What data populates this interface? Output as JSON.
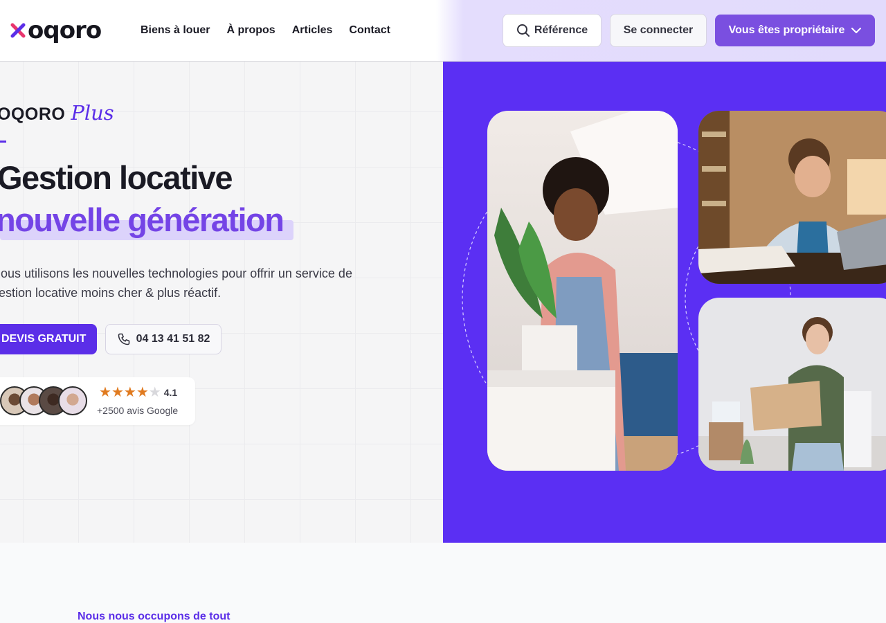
{
  "header": {
    "logo_text": "oqoro",
    "nav": [
      "Biens à louer",
      "À propos",
      "Articles",
      "Contact"
    ],
    "reference_label": "Référence",
    "login_label": "Se connecter",
    "owner_label": "Vous êtes propriétaire"
  },
  "hero": {
    "brand_name": "OQORO",
    "brand_plus": "Plus",
    "title_line1": "Gestion locative",
    "title_line2": "nouvelle génération",
    "lead": "Nous utilisons les nouvelles technologies pour offrir un service de gestion locative moins cher & plus réactif.",
    "cta_primary": "DEVIS GRATUIT",
    "cta_phone": "04 13 41 51 82",
    "rating": "4.1",
    "rating_value": 4.1,
    "rating_max": 5,
    "reviews": "+2500 avis Google"
  },
  "colors": {
    "brand": "#5b2ee8",
    "hero_panel": "#5b2ff3",
    "star": "#e07a1f"
  },
  "next_section": {
    "eyebrow": "Nous nous occupons de tout"
  }
}
